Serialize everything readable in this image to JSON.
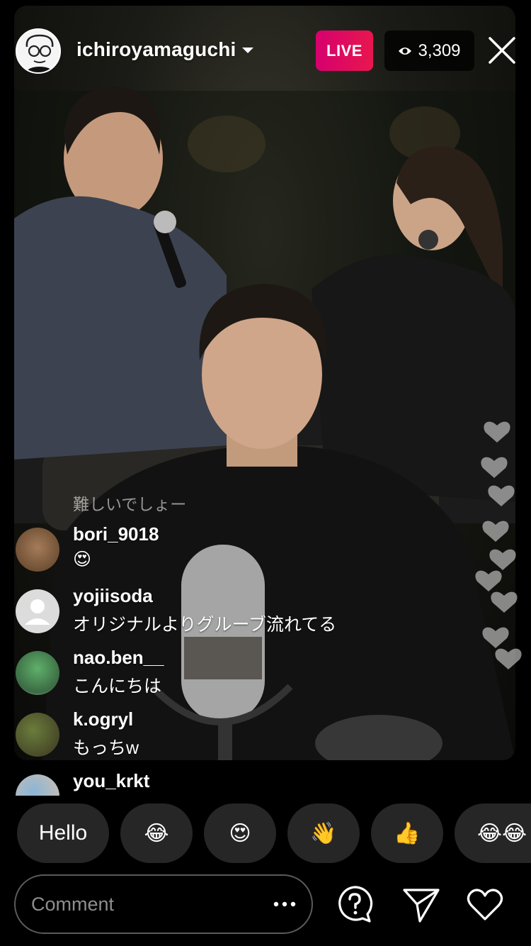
{
  "header": {
    "host_username": "ichiroyamaguchi",
    "live_label": "LIVE",
    "viewer_count": "3,309",
    "brand_colors": {
      "live_start": "#d6006e",
      "live_end": "#e8174f"
    }
  },
  "comments": {
    "system_message": "難しいでしょー",
    "items": [
      {
        "user": "bori_9018",
        "text": "😍"
      },
      {
        "user": "yojiisoda",
        "text": "オリジナルよりグルーブ流れてる"
      },
      {
        "user": "nao.ben__",
        "text": "こんにちは"
      },
      {
        "user": "k.ogryl",
        "text": "もっちw"
      },
      {
        "user": "you_krkt",
        "text": ""
      }
    ]
  },
  "quick_reactions": [
    "Hello",
    "😂",
    "😍",
    "👋",
    "👍",
    "😂😂"
  ],
  "composer": {
    "placeholder": "Comment",
    "icons": [
      "question-icon",
      "send-icon",
      "heart-icon"
    ]
  }
}
